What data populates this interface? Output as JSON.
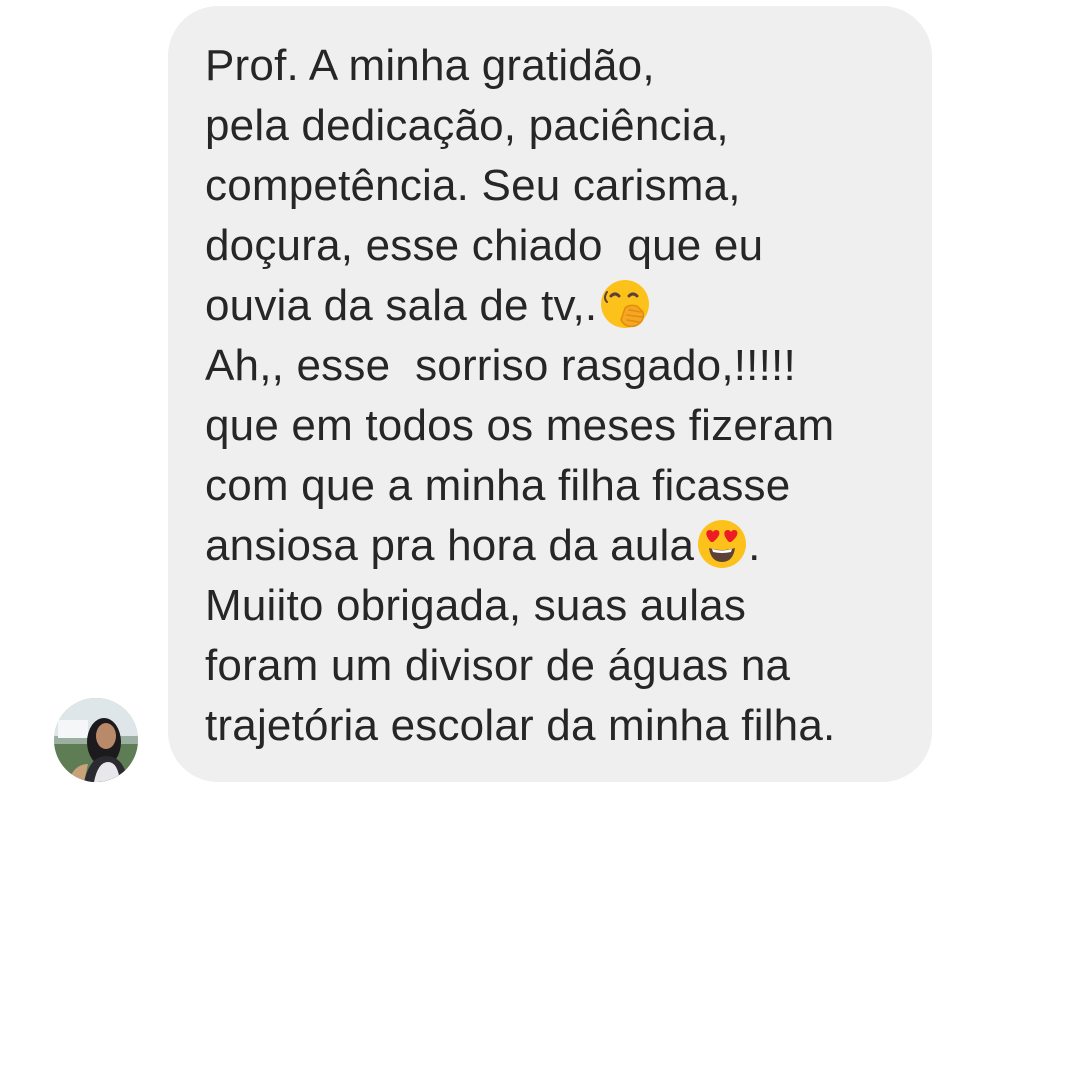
{
  "message": {
    "lines": [
      "Prof. A minha gratidão,",
      "pela dedicação, paciência,",
      "competência. Seu carisma,",
      "doçura, esse chiado  que eu",
      "ouvia da sala de tv,.",
      "Ah,, esse  sorriso rasgado,!!!!!",
      "que em todos os meses fizeram",
      "com que a minha filha ficasse",
      "ansiosa pra hora da aula",
      "Muiito obrigada, suas aulas",
      "foram um divisor de águas na",
      "trajetória escolar da minha filha."
    ],
    "line9_suffix": ".",
    "emojis": {
      "line5": "face-with-hand-over-mouth-emoji",
      "line9": "smiling-face-with-heart-eyes-emoji"
    }
  },
  "colors": {
    "bubble": "#efefef",
    "text": "#262626",
    "background": "#ffffff",
    "emoji_yellow": "#fcc21b"
  }
}
